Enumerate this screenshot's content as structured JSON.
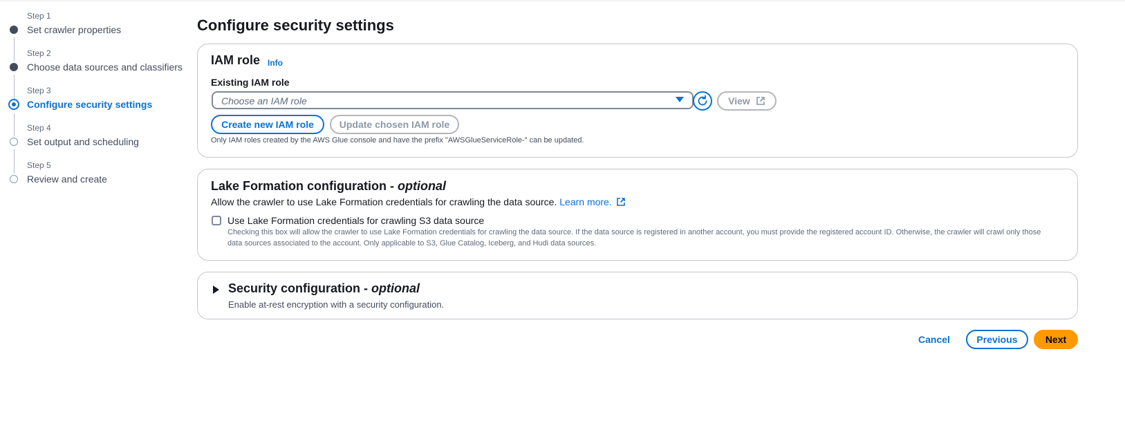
{
  "steps": [
    {
      "num": "Step 1",
      "title": "Set crawler properties",
      "state": "done"
    },
    {
      "num": "Step 2",
      "title": "Choose data sources and classifiers",
      "state": "done"
    },
    {
      "num": "Step 3",
      "title": "Configure security settings",
      "state": "active"
    },
    {
      "num": "Step 4",
      "title": "Set output and scheduling",
      "state": "todo"
    },
    {
      "num": "Step 5",
      "title": "Review and create",
      "state": "todo"
    }
  ],
  "page_title": "Configure security settings",
  "iam": {
    "heading": "IAM role",
    "info": "Info",
    "field_label": "Existing IAM role",
    "select_placeholder": "Choose an IAM role",
    "view_label": "View",
    "create_label": "Create new IAM role",
    "update_label": "Update chosen IAM role",
    "hint": "Only IAM roles created by the AWS Glue console and have the prefix \"AWSGlueServiceRole-\" can be updated."
  },
  "lake": {
    "heading": "Lake Formation configuration -",
    "heading_optional": "optional",
    "description": "Allow the crawler to use Lake Formation credentials for crawling the data source.",
    "learn_more": "Learn more.",
    "checkbox_label": "Use Lake Formation credentials for crawling S3 data source",
    "checkbox_checked": false,
    "checkbox_desc": "Checking this box will allow the crawler to use Lake Formation credentials for crawling the data source. If the data source is registered in another account, you must provide the registered account ID. Otherwise, the crawler will crawl only those data sources associated to the account. Only applicable to S3, Glue Catalog, Iceberg, and Hudi data sources."
  },
  "security": {
    "heading": "Security configuration -",
    "heading_optional": "optional",
    "description": "Enable at-rest encryption with a security configuration."
  },
  "footer": {
    "cancel": "Cancel",
    "previous": "Previous",
    "next": "Next"
  },
  "colors": {
    "accent": "#0972d3",
    "primary_button": "#ff9900"
  }
}
